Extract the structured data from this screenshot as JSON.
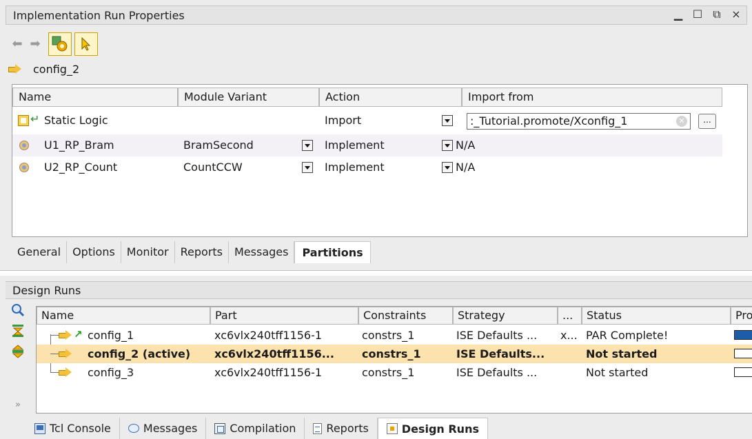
{
  "properties_panel": {
    "title": "Implementation Run Properties",
    "window_controls": [
      "_",
      "□",
      "ð",
      "×"
    ],
    "object_name": "config_2",
    "columns": [
      "Name",
      "Module Variant",
      "Action",
      "Import from"
    ],
    "rows": [
      {
        "name": "Static Logic",
        "variant": "",
        "action": "Import",
        "import_from": ":_Tutorial.promote/Xconfig_1",
        "browse": "..."
      },
      {
        "name": "U1_RP_Bram",
        "variant": "BramSecond",
        "action": "Implement",
        "import_from": "N/A"
      },
      {
        "name": "U2_RP_Count",
        "variant": "CountCCW",
        "action": "Implement",
        "import_from": "N/A"
      }
    ],
    "tabs": [
      "General",
      "Options",
      "Monitor",
      "Reports",
      "Messages",
      "Partitions"
    ],
    "active_tab": "Partitions"
  },
  "runs_panel": {
    "title": "Design Runs",
    "columns": [
      "Name",
      "Part",
      "Constraints",
      "Strategy",
      "...",
      "Status",
      "Pro"
    ],
    "rows": [
      {
        "name": "config_1",
        "part": "xc6vlx240tff1156-1",
        "constraints": "constrs_1",
        "strategy": "ISE Defaults ...",
        "extra": "x...",
        "status": "PAR Complete!",
        "progress": 1.0
      },
      {
        "name": "config_2 (active)",
        "part": "xc6vlx240tff1156...",
        "constraints": "constrs_1",
        "strategy": "ISE Defaults...",
        "extra": "",
        "status": "Not started",
        "progress": 0.0
      },
      {
        "name": "config_3",
        "part": "xc6vlx240tff1156-1",
        "constraints": "constrs_1",
        "strategy": "ISE Defaults ...",
        "extra": "",
        "status": "Not started",
        "progress": 0.0
      }
    ],
    "collapse_glyph": "»"
  },
  "bottom_tabs": [
    {
      "label": "Tcl Console",
      "icon": "console-icon"
    },
    {
      "label": "Messages",
      "icon": "messages-icon"
    },
    {
      "label": "Compilation",
      "icon": "compilation-icon"
    },
    {
      "label": "Reports",
      "icon": "reports-icon"
    },
    {
      "label": "Design Runs",
      "icon": "design-runs-icon"
    }
  ],
  "active_bottom_tab": "Design Runs",
  "colors": {
    "active_row": "#fce2ad",
    "progress_fill": "#1d5ca8",
    "panel_bg": "#ececec"
  }
}
